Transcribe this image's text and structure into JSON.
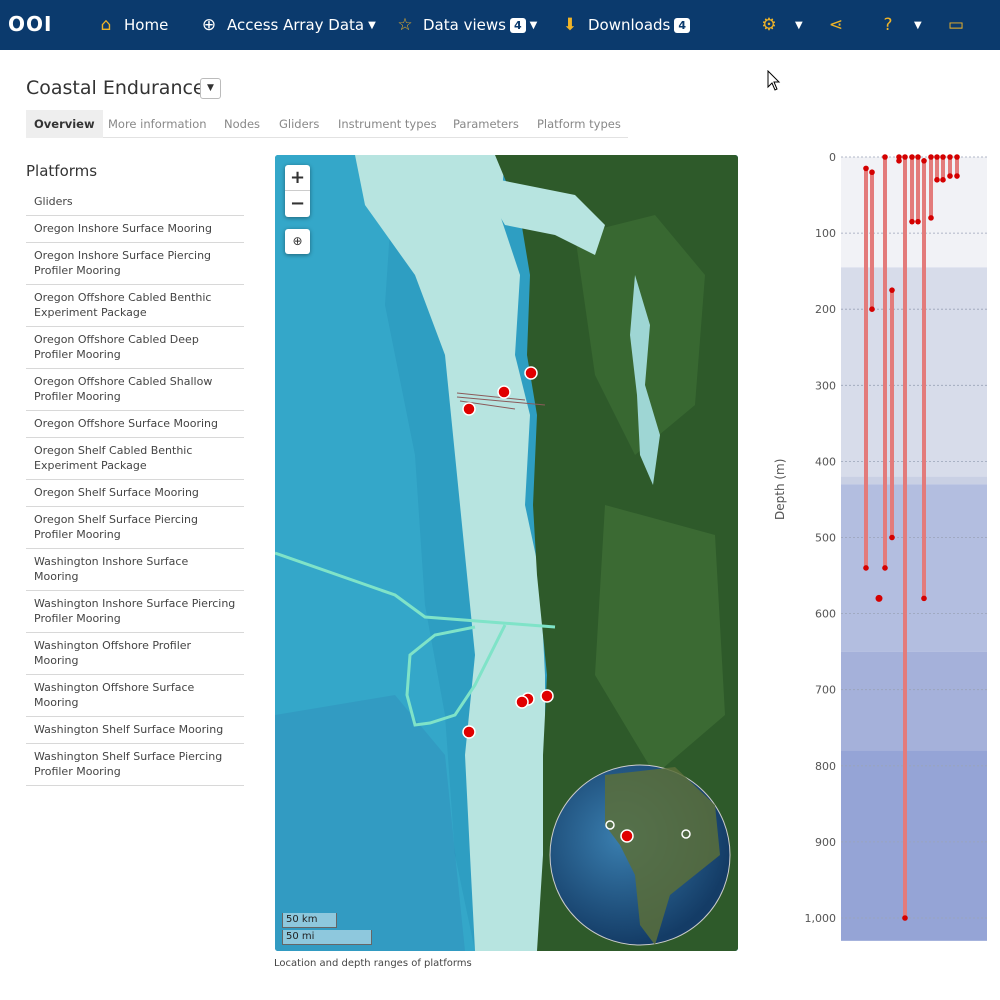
{
  "navbar": {
    "logo": "OOI",
    "home": "Home",
    "access": "Access Array Data",
    "dataviews": "Data views",
    "dataviews_count": "4",
    "downloads": "Downloads",
    "downloads_count": "4"
  },
  "page": {
    "title": "Coastal Endurance",
    "tabs": [
      "Overview",
      "More information",
      "Nodes",
      "Gliders",
      "Instrument types",
      "Parameters",
      "Platform types"
    ]
  },
  "sidebar": {
    "title": "Platforms",
    "items": [
      "Gliders",
      "Oregon Inshore Surface Mooring",
      "Oregon Inshore Surface Piercing Profiler Mooring",
      "Oregon Offshore Cabled Benthic Experiment Package",
      "Oregon Offshore Cabled Deep Profiler Mooring",
      "Oregon Offshore Cabled Shallow Profiler Mooring",
      "Oregon Offshore Surface Mooring",
      "Oregon Shelf Cabled Benthic Experiment Package",
      "Oregon Shelf Surface Mooring",
      "Oregon Shelf Surface Piercing Profiler Mooring",
      "Washington Inshore Surface Mooring",
      "Washington Inshore Surface Piercing Profiler Mooring",
      "Washington Offshore Profiler Mooring",
      "Washington Offshore Surface Mooring",
      "Washington Shelf Surface Mooring",
      "Washington Shelf Surface Piercing Profiler Mooring"
    ]
  },
  "map": {
    "zoom_in": "+",
    "zoom_out": "−",
    "scale_km": "50 km",
    "scale_mi": "50 mi",
    "caption": "Location and depth ranges of platforms"
  },
  "chart_data": {
    "type": "range",
    "ylabel": "Depth (m)",
    "ylim": [
      0,
      1030
    ],
    "yticks": [
      0,
      100,
      200,
      300,
      400,
      500,
      600,
      700,
      800,
      900,
      1000
    ],
    "ytick_labels": [
      "0",
      "100",
      "200",
      "300",
      "400",
      "500",
      "600",
      "700",
      "800",
      "900",
      "1,000"
    ],
    "ranges": [
      [
        15,
        540
      ],
      [
        20,
        200
      ],
      [
        0,
        540
      ],
      [
        175,
        500
      ],
      [
        0,
        5
      ],
      [
        0,
        1000
      ],
      [
        0,
        85
      ],
      [
        0,
        85
      ],
      [
        5,
        580
      ],
      [
        0,
        80
      ],
      [
        0,
        30
      ],
      [
        0,
        30
      ],
      [
        0,
        25
      ],
      [
        0,
        25
      ]
    ],
    "points": [
      580
    ],
    "colors": {
      "range": "#e37b7b",
      "point": "#d40000"
    }
  }
}
